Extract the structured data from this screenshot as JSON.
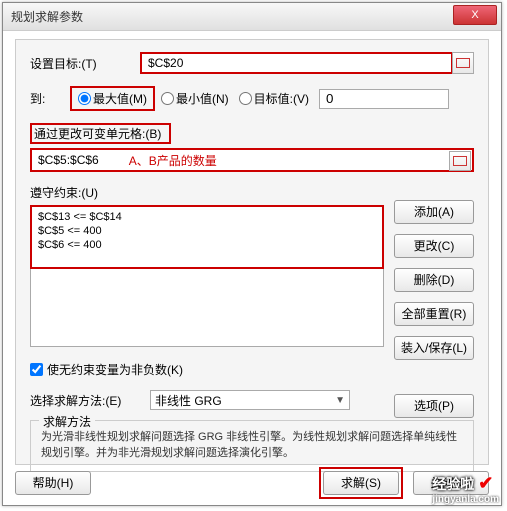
{
  "window": {
    "title": "规划求解参数",
    "close": "X"
  },
  "labels": {
    "set_target": "设置目标:(T)",
    "to": "到:",
    "by_changing": "通过更改可变单元格:(B)",
    "constraints": "遵守约束:(U)",
    "nonneg_cb": "使无约束变量为非负数(K)",
    "select_method": "选择求解方法:(E)",
    "method_legend": "求解方法",
    "method_desc": "为光滑非线性规划求解问题选择 GRG 非线性引擎。为线性规划求解问题选择单纯线性规划引擎。并为非光滑规划求解问题选择演化引擎。"
  },
  "values": {
    "target_cell": "$C$20",
    "radio_max": "最大值(M)",
    "radio_min": "最小值(N)",
    "radio_val": "目标值:(V)",
    "value_of": "0",
    "cells": "$C$5:$C$6",
    "cells_note": "A、B产品的数量",
    "constraints_lines": [
      "$C$13 <= $C$14",
      "$C$5 <= 400",
      "$C$6 <= 400"
    ],
    "method": "非线性 GRG"
  },
  "buttons": {
    "add": "添加(A)",
    "change": "更改(C)",
    "delete": "删除(D)",
    "reset": "全部重置(R)",
    "load": "装入/保存(L)",
    "options": "选项(P)",
    "help": "帮助(H)",
    "solve": "求解(S)",
    "close": "关闭(O)"
  },
  "watermark": {
    "text": "经验啦",
    "url": "jingyanla.com"
  }
}
